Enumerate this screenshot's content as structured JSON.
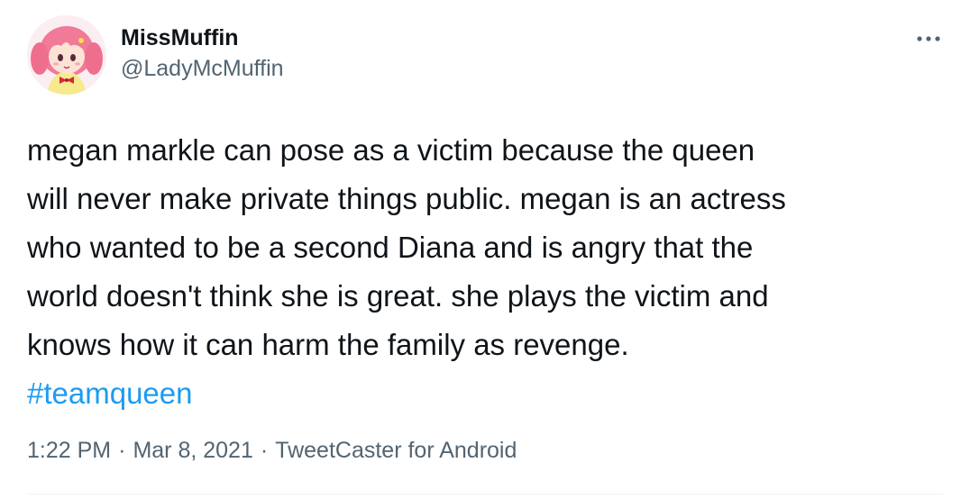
{
  "author": {
    "display_name": "MissMuffin",
    "handle": "@LadyMcMuffin",
    "avatar_icon": "anime-girl-avatar-icon"
  },
  "tweet": {
    "text": "megan markle can pose as a victim because the queen\nwill never make private things public. megan is an actress\nwho wanted to be a second Diana and is angry that the\nworld doesn't think she is great. she plays the victim and\nknows how it can harm the family as revenge.",
    "hashtag": "#teamqueen"
  },
  "meta": {
    "time": "1:22 PM",
    "separator": "·",
    "date": "Mar 8, 2021",
    "source": "TweetCaster for Android"
  },
  "colors": {
    "hashtag": "#1d9bf0",
    "secondary_text": "#536471",
    "primary_text": "#0f1419"
  }
}
